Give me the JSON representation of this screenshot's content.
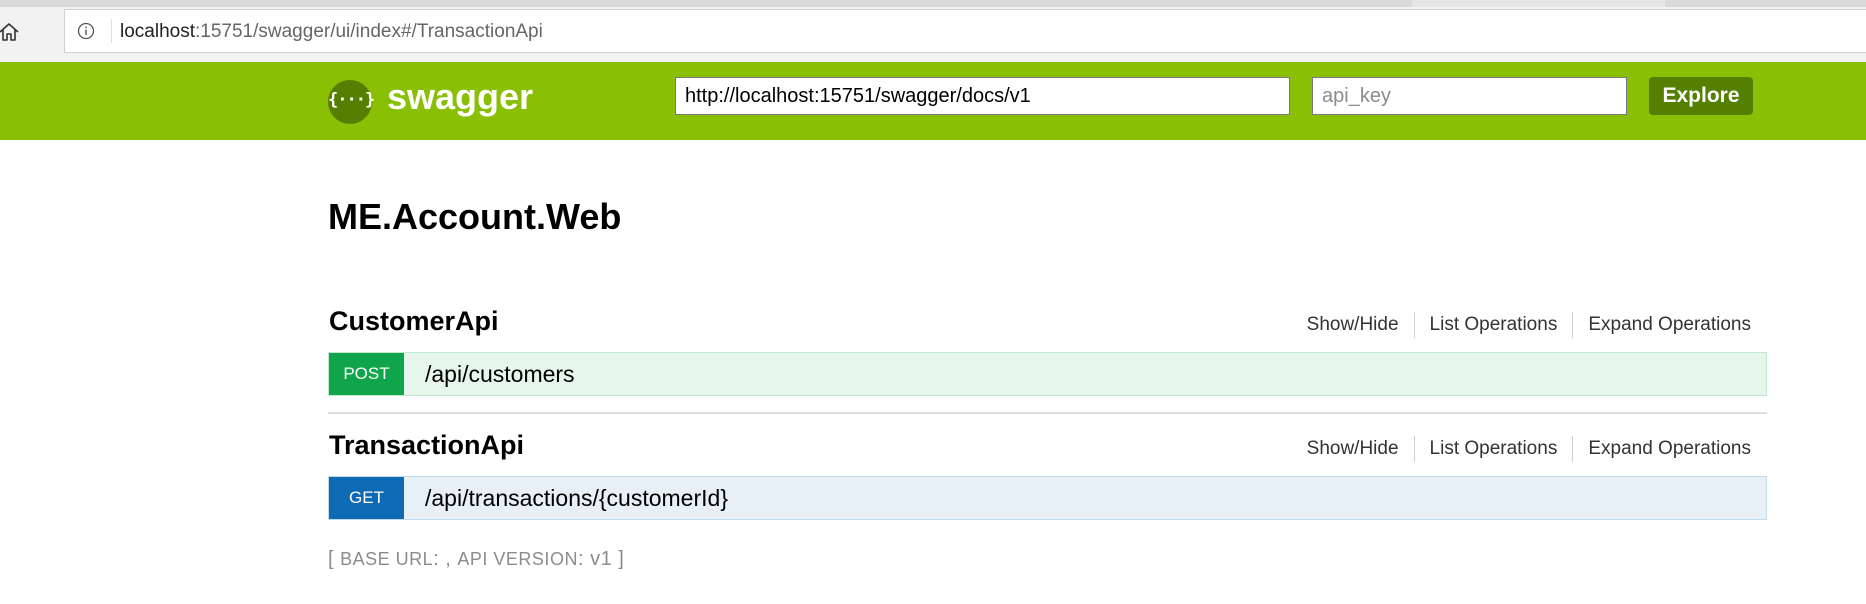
{
  "browser": {
    "url_host": "localhost",
    "url_rest": ":15751/swagger/ui/index#/TransactionApi"
  },
  "header": {
    "logo_glyph": "{···}",
    "brand": "swagger",
    "url_value": "http://localhost:15751/swagger/docs/v1",
    "api_key_placeholder": "api_key",
    "explore_label": "Explore",
    "bg_color": "#89bf04"
  },
  "main": {
    "title": "ME.Account.Web",
    "resources": [
      {
        "name": "CustomerApi",
        "links": [
          "Show/Hide",
          "List Operations",
          "Expand Operations"
        ],
        "operations": [
          {
            "method": "POST",
            "path": "/api/customers",
            "color": "#10a54a"
          }
        ]
      },
      {
        "name": "TransactionApi",
        "links": [
          "Show/Hide",
          "List Operations",
          "Expand Operations"
        ],
        "operations": [
          {
            "method": "GET",
            "path": "/api/transactions/{customerId}",
            "color": "#0f6ab4"
          }
        ]
      }
    ],
    "footer": {
      "open": "[ ",
      "base_url_label": "BASE URL",
      "sep": ": , ",
      "api_version_label": "API VERSION",
      "version_sep": ": ",
      "version": "v1",
      "close": " ]"
    }
  }
}
